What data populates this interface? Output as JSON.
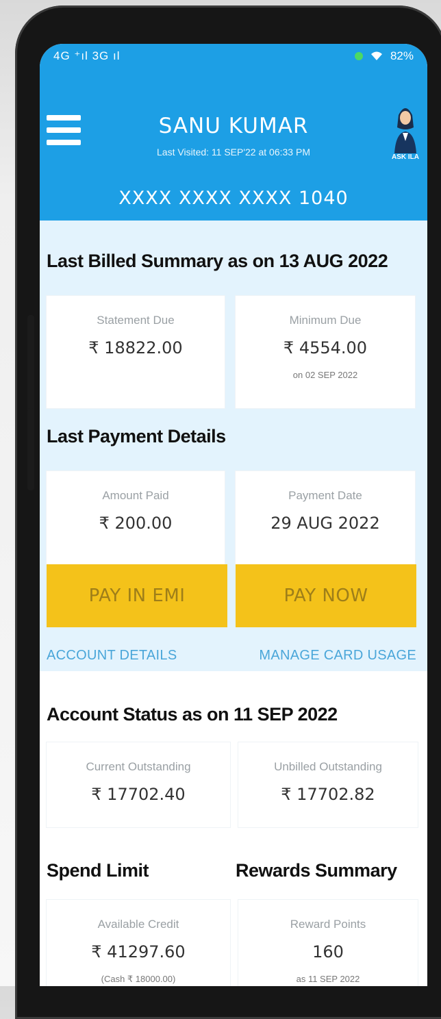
{
  "status_bar": {
    "left_text": "4G ⁺ıl 3G ıl",
    "right_text": "82%"
  },
  "header": {
    "user_name": "SANU KUMAR",
    "last_visited": "Last Visited: 11 SEP'22 at 06:33 PM",
    "card_number": "XXXX XXXX XXXX 1040",
    "avatar_label": "ASK ILA"
  },
  "billed_summary": {
    "title": "Last Billed Summary as on 13 AUG 2022",
    "statement_due_label": "Statement Due",
    "statement_due_value": "₹ 18822.00",
    "minimum_due_label": "Minimum Due",
    "minimum_due_value": "₹ 4554.00",
    "minimum_due_date": "on 02 SEP 2022"
  },
  "last_payment": {
    "title": "Last Payment Details",
    "amount_paid_label": "Amount Paid",
    "amount_paid_value": "₹ 200.00",
    "payment_date_label": "Payment Date",
    "payment_date_value": "29 AUG 2022"
  },
  "actions": {
    "pay_in_emi": "PAY IN EMI",
    "pay_now": "PAY NOW",
    "account_details": "ACCOUNT DETAILS",
    "manage_card_usage": "MANAGE CARD USAGE"
  },
  "account_status": {
    "title": "Account Status as on 11 SEP 2022",
    "current_outstanding_label": "Current Outstanding",
    "current_outstanding_value": "₹ 17702.40",
    "unbilled_outstanding_label": "Unbilled Outstanding",
    "unbilled_outstanding_value": "₹ 17702.82"
  },
  "spend_limit": {
    "title": "Spend Limit",
    "available_credit_label": "Available Credit",
    "available_credit_value": "₹ 41297.60",
    "available_cash": "(Cash ₹ 18000.00)"
  },
  "rewards": {
    "title": "Rewards Summary",
    "reward_points_label": "Reward Points",
    "reward_points_value": "160",
    "reward_points_date": "as 11 SEP 2022"
  },
  "colors": {
    "header_blue": "#1d9fe5",
    "light_section": "#e3f3fd",
    "button_yellow": "#f4c21a",
    "link_blue": "#4aa6d9"
  }
}
